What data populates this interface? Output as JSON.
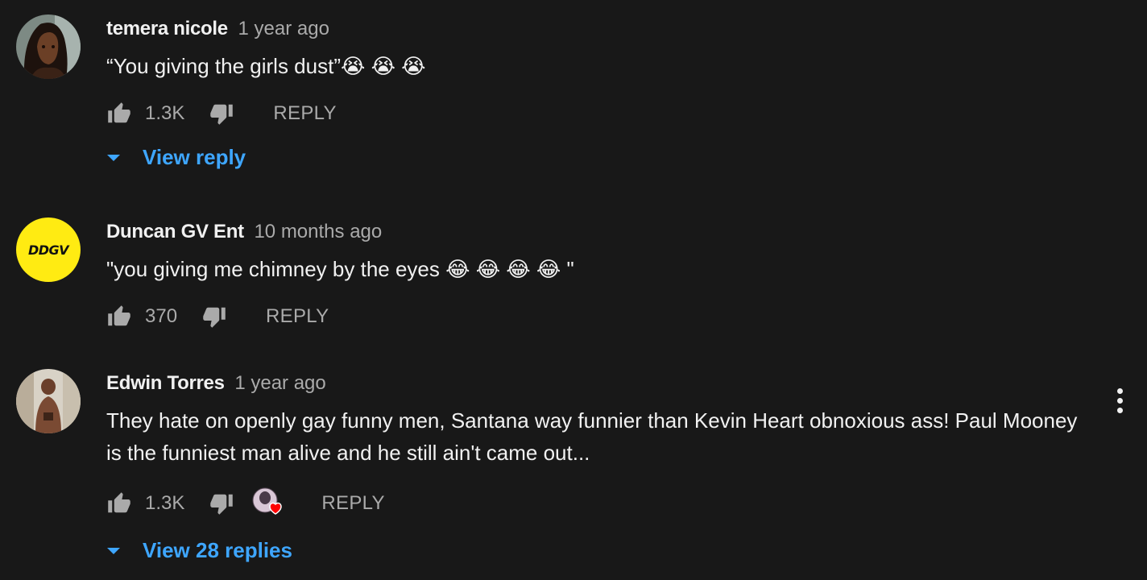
{
  "comments": [
    {
      "author": "temera nicole",
      "time": "1 year ago",
      "text": "“You giving the girls dust”😭 😭 😭",
      "likes": "1.3K",
      "reply_label": "REPLY",
      "replies_label": "View reply",
      "avatar_icon": "anime-portrait-avatar"
    },
    {
      "author": "Duncan GV Ent",
      "time": "10 months ago",
      "text": "\"you giving me chimney by the eyes 😂 😂 😂 😂 \"",
      "likes": "370",
      "reply_label": "REPLY",
      "avatar_text": "DDGV",
      "avatar_color": "#ffeb12"
    },
    {
      "author": "Edwin Torres",
      "time": "1 year ago",
      "text": "They hate on openly gay funny men, Santana way funnier than Kevin Heart obnoxious ass!  Paul Mooney is the funniest man alive and he still ain't came out...",
      "likes": "1.3K",
      "reply_label": "REPLY",
      "replies_label": "View 28 replies",
      "avatar_icon": "photo-avatar",
      "creator_heart": true
    }
  ],
  "colors": {
    "background": "#181818",
    "text": "#f1f1f1",
    "secondary": "#aaaaaa",
    "link": "#3ea6ff",
    "heart": "#ff0000"
  },
  "icons": [
    "thumb-up-icon",
    "thumb-down-icon",
    "more-vert-icon",
    "caret-down-icon",
    "heart-icon"
  ]
}
